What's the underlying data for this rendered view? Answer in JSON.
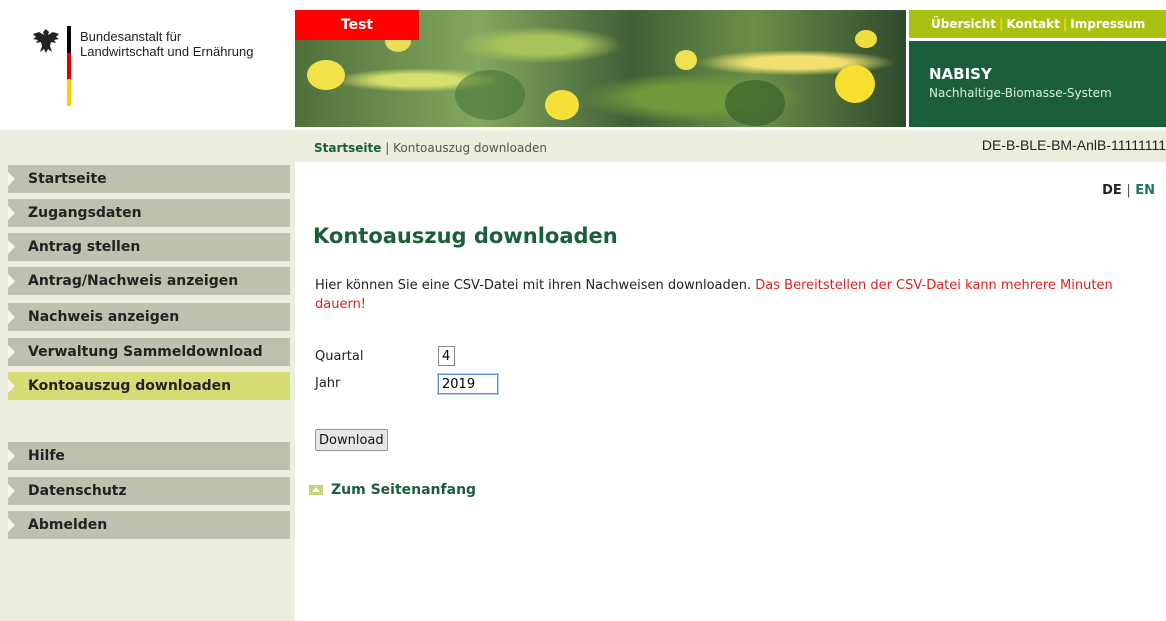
{
  "org": {
    "line1": "Bundesanstalt für",
    "line2": "Landwirtschaft und Ernährung"
  },
  "banner": {
    "test_label": "Test"
  },
  "top_nav": {
    "items": [
      "Übersicht",
      "Kontakt",
      "Impressum"
    ],
    "separator": "|"
  },
  "brand": {
    "title": "NABISY",
    "subtitle": "Nachhaltige-Biomasse-System"
  },
  "breadcrumb": {
    "home": "Startseite",
    "separator": "|",
    "current": "Kontoauszug downloaden"
  },
  "account_id": "DE-B-BLE-BM-AnlB-11111111",
  "sidebar": {
    "items": [
      {
        "label": "Startseite"
      },
      {
        "label": "Zugangsdaten"
      },
      {
        "label": "Antrag stellen"
      },
      {
        "label": "Antrag/Nachweis anzeigen"
      },
      {
        "label": "Nachweis anzeigen"
      },
      {
        "label": "Verwaltung Sammeldownload"
      },
      {
        "label": "Kontoauszug downloaden",
        "active": true
      },
      {
        "label": "Hilfe"
      },
      {
        "label": "Datenschutz"
      },
      {
        "label": "Abmelden"
      }
    ]
  },
  "language": {
    "de": "DE",
    "separator": "|",
    "en": "EN"
  },
  "main": {
    "title": "Kontoauszug downloaden",
    "info_text": "Hier können Sie eine CSV-Datei mit ihren Nachweisen downloaden.",
    "warning_text": "Das Bereitstellen der CSV-Datei kann mehrere Minuten dauern!",
    "form": {
      "quarter_label": "Quartal",
      "quarter_value": "4",
      "year_label": "Jahr",
      "year_value": "2019",
      "download_label": "Download"
    },
    "back_to_top": "Zum Seitenanfang"
  },
  "colors": {
    "brand_green": "#1b5e3b",
    "nav_lime": "#a9c211",
    "active_nav": "#d5dc74",
    "nav_bg": "#c0c0b0",
    "warning": "#e02020",
    "test_red": "#ff0000"
  }
}
